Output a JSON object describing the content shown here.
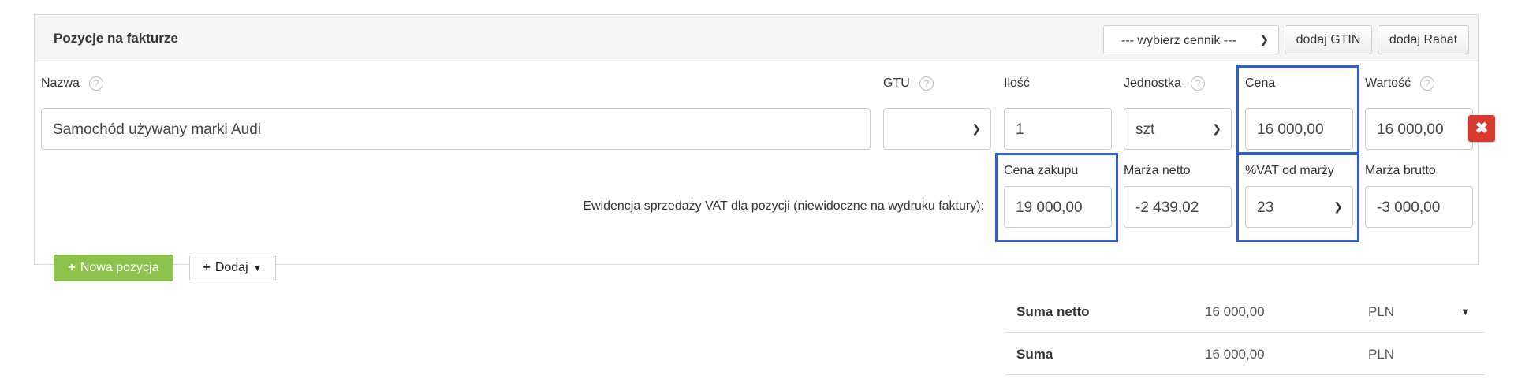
{
  "panel": {
    "title": "Pozycje na fakturze",
    "pricelist_select": "--- wybierz cennik ---",
    "add_gtin_label": "dodaj GTIN",
    "add_discount_label": "dodaj Rabat"
  },
  "columns": {
    "name": "Nazwa",
    "gtu": "GTU",
    "quantity": "Ilość",
    "unit": "Jednostka",
    "price": "Cena",
    "value": "Wartość"
  },
  "item": {
    "name": "Samochód używany marki Audi",
    "gtu": "",
    "quantity": "1",
    "unit": "szt",
    "price": "16 000,00",
    "value": "16 000,00"
  },
  "vat_margin": {
    "note": "Ewidencja sprzedaży VAT dla pozycji (niewidoczne na wydruku faktury):",
    "purchase_price_label": "Cena zakupu",
    "purchase_price": "19 000,00",
    "net_margin_label": "Marża netto",
    "net_margin": "-2 439,02",
    "vat_rate_label": "%VAT od marży",
    "vat_rate": "23",
    "gross_margin_label": "Marża brutto",
    "gross_margin": "-3 000,00"
  },
  "actions": {
    "new_item_label": "Nowa pozycja",
    "add_label": "Dodaj"
  },
  "summary": {
    "net_label": "Suma netto",
    "net_value": "16 000,00",
    "net_currency": "PLN",
    "total_label": "Suma",
    "total_value": "16 000,00",
    "total_currency": "PLN"
  },
  "colors": {
    "highlight": "#2d5fd3",
    "delete": "#d9382c",
    "new_item": "#8bc34a"
  }
}
